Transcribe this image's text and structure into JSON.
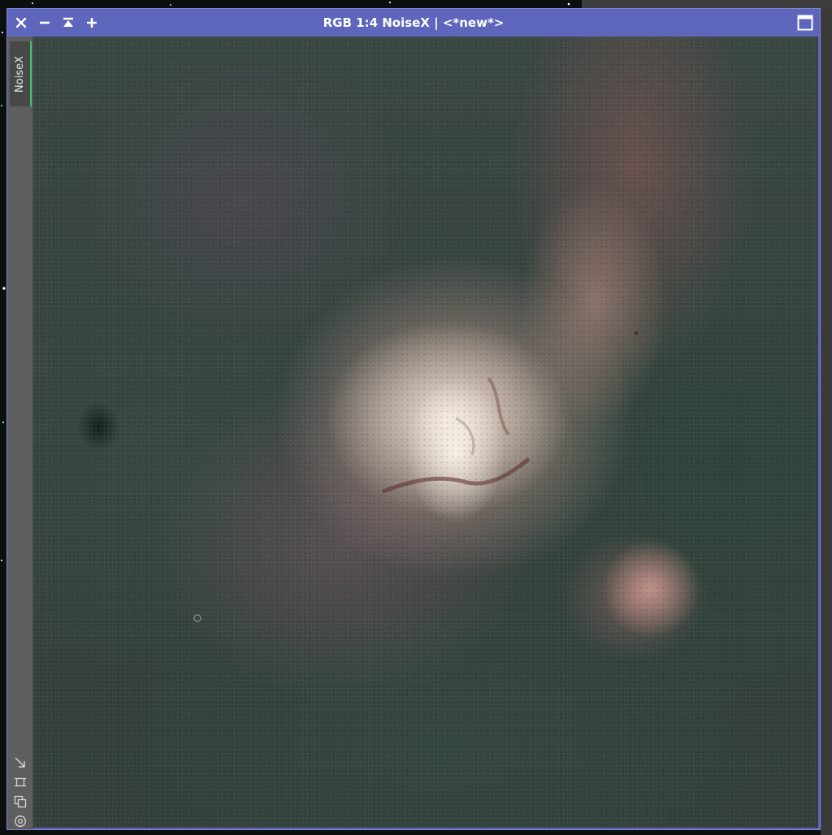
{
  "window": {
    "title": "RGB 1:4 NoiseX | <*new*>",
    "titlebar_color": "#5d66bb"
  },
  "titlebar": {
    "buttons": [
      {
        "name": "close",
        "icon": "close-icon"
      },
      {
        "name": "minimize",
        "icon": "minus-icon"
      },
      {
        "name": "shade",
        "icon": "shade-icon"
      },
      {
        "name": "zoom-in",
        "icon": "plus-icon"
      }
    ],
    "maximize_icon": "maximize-icon"
  },
  "side_panel": {
    "tab_label": "NoiseX",
    "tab_indicator_color": "#3fc468",
    "tools": [
      {
        "name": "fit-view",
        "icon": "fit-arrow-icon"
      },
      {
        "name": "crop-view",
        "icon": "crop-icon"
      },
      {
        "name": "clone-view",
        "icon": "clone-icon"
      },
      {
        "name": "identity-view",
        "icon": "target-icon"
      }
    ]
  },
  "image": {
    "description_kind": "astrophotograph",
    "colors": {
      "core": "#f5ebe0",
      "emission": "#d6aaa0",
      "background": "#3a4642"
    }
  }
}
